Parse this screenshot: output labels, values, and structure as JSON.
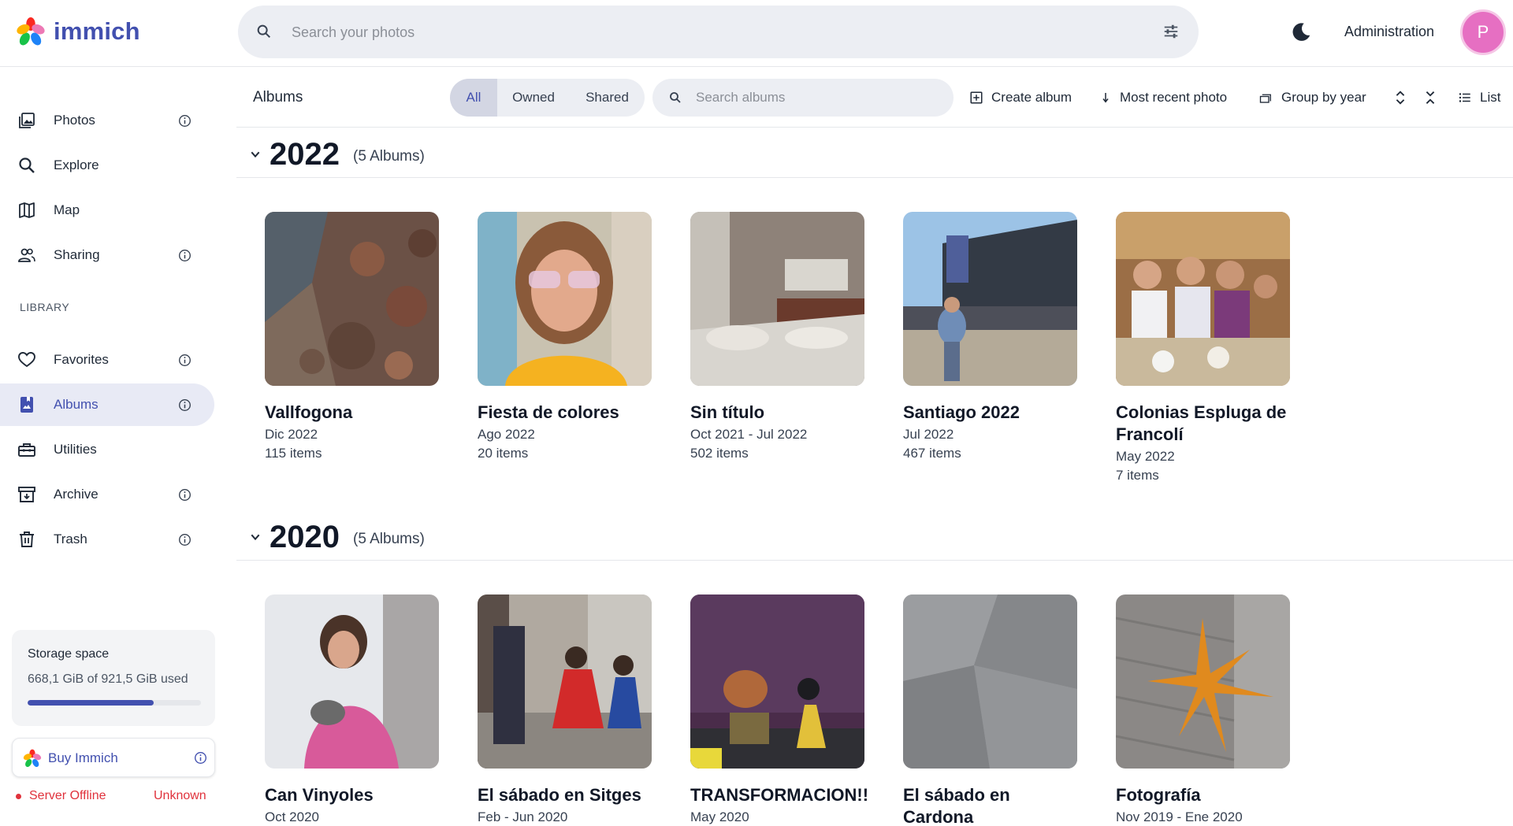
{
  "app": {
    "name": "immich"
  },
  "header": {
    "search_placeholder": "Search your photos",
    "admin_label": "Administration",
    "avatar_initial": "P"
  },
  "sidebar": {
    "items": [
      {
        "label": "Photos",
        "icon": "photos-icon"
      },
      {
        "label": "Explore",
        "icon": "search-icon"
      },
      {
        "label": "Map",
        "icon": "map-icon"
      },
      {
        "label": "Sharing",
        "icon": "people-icon"
      }
    ],
    "library_label": "LIBRARY",
    "library_items": [
      {
        "label": "Favorites",
        "icon": "heart-icon"
      },
      {
        "label": "Albums",
        "icon": "album-icon"
      },
      {
        "label": "Utilities",
        "icon": "toolbox-icon"
      },
      {
        "label": "Archive",
        "icon": "archive-icon"
      },
      {
        "label": "Trash",
        "icon": "trash-icon"
      }
    ],
    "storage": {
      "title": "Storage space",
      "used_text": "668,1 GiB of 921,5 GiB used",
      "used_fraction": 0.725
    },
    "buy_label": "Buy Immich",
    "server_status": "Server Offline",
    "server_version": "Unknown"
  },
  "toolbar": {
    "title": "Albums",
    "filters": [
      "All",
      "Owned",
      "Shared"
    ],
    "active_filter": "All",
    "search_placeholder": "Search albums",
    "create_label": "Create album",
    "sort_label": "Most recent photo",
    "group_label": "Group by year",
    "view_label": "List"
  },
  "groups": [
    {
      "year": "2022",
      "count": "(5 Albums)",
      "albums": [
        {
          "title": "Vallfogona",
          "dates": "Dic 2022",
          "items": "115 items"
        },
        {
          "title": "Fiesta de colores",
          "dates": "Ago 2022",
          "items": "20 items"
        },
        {
          "title": "Sin título",
          "dates": "Oct 2021 - Jul 2022",
          "items": "502 items"
        },
        {
          "title": "Santiago 2022",
          "dates": "Jul 2022",
          "items": "467 items"
        },
        {
          "title": "Colonias Espluga de Francolí",
          "dates": "May 2022",
          "items": "7 items"
        }
      ]
    },
    {
      "year": "2020",
      "count": "(5 Albums)",
      "albums": [
        {
          "title": "Can Vinyoles",
          "dates": "Oct 2020",
          "items": ""
        },
        {
          "title": "El sábado en Sitges",
          "dates": "Feb - Jun 2020",
          "items": ""
        },
        {
          "title": "TRANSFORMACION!!",
          "dates": "May 2020",
          "items": ""
        },
        {
          "title": "El sábado en Cardona",
          "dates": "",
          "items": ""
        },
        {
          "title": "Fotografía",
          "dates": "Nov 2019 - Ene 2020",
          "items": ""
        }
      ]
    }
  ],
  "colors": {
    "accent": "#4250af",
    "avatar": "#e66fc2",
    "offline": "#e0323c"
  }
}
